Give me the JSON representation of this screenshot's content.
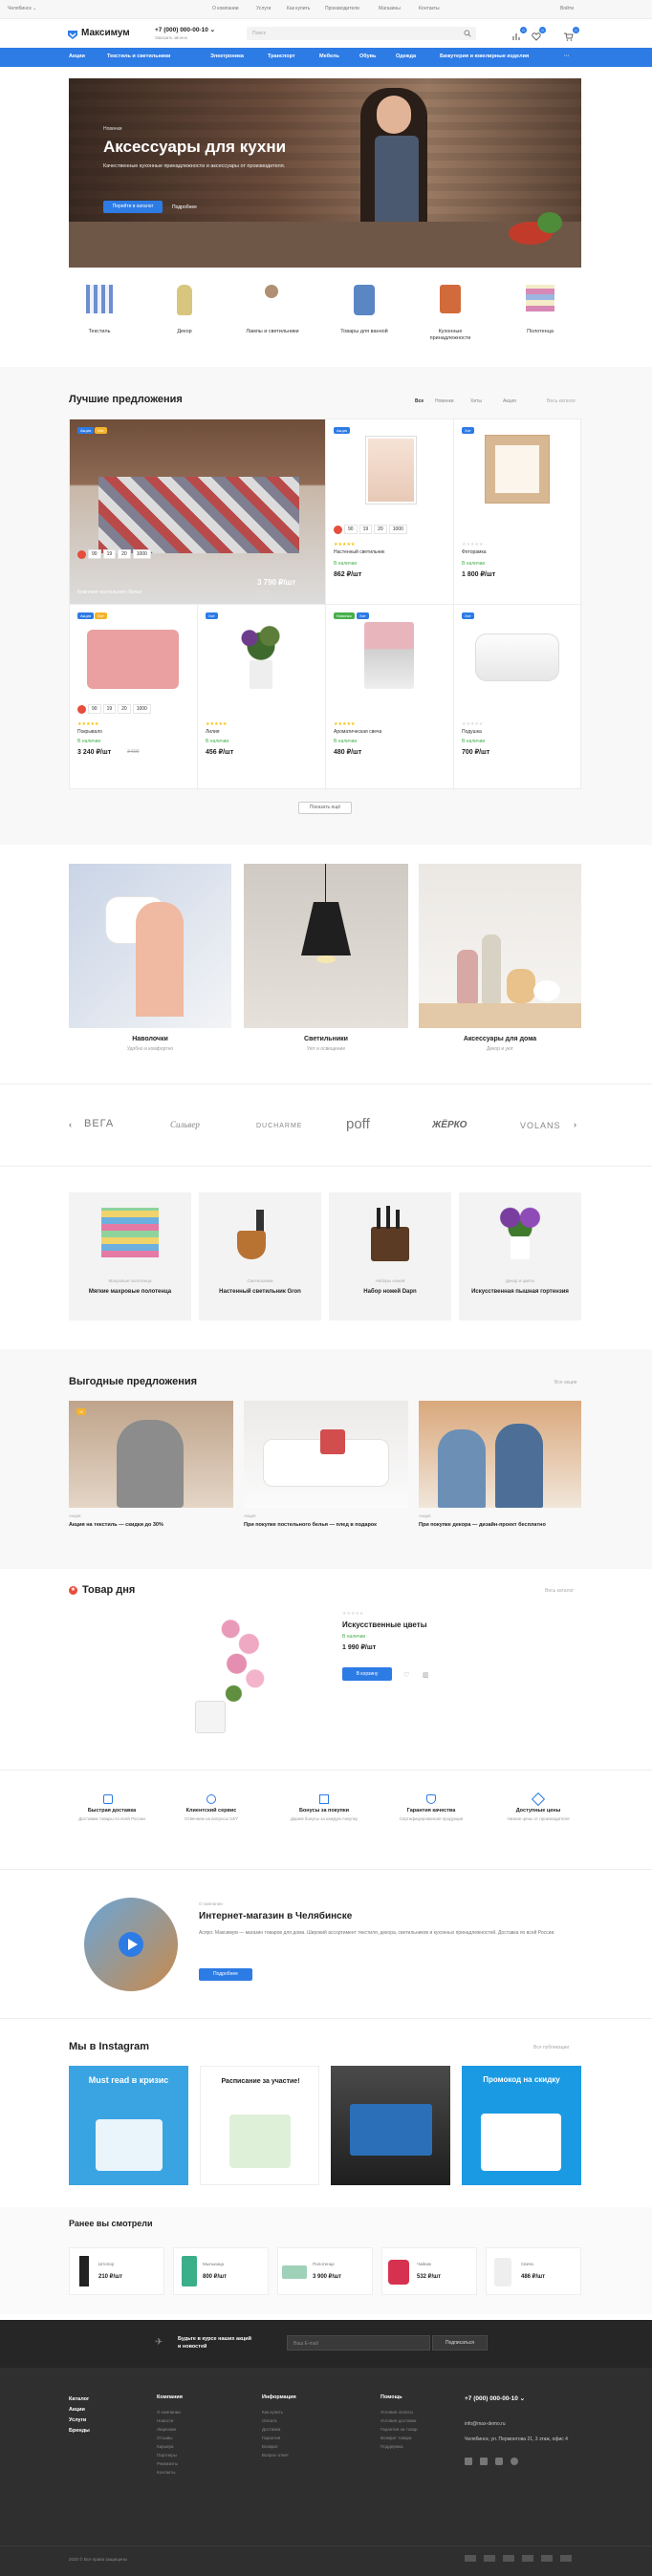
{
  "topbar": {
    "city": "Челябинск ⌄",
    "links": [
      "О компании",
      "Услуги",
      "Как купить",
      "Производители",
      "Магазины",
      "Контакты"
    ],
    "login": "Войти"
  },
  "header": {
    "logo": "Максимум",
    "phone": "+7 (000) 000-00-10 ⌄",
    "phone_sub": "Заказать звонок",
    "search_placeholder": "Поиск",
    "compare_count": "0",
    "fav_count": "0",
    "cart_count": "0"
  },
  "nav": {
    "items": [
      "Акции",
      "Текстиль и светильники",
      "Электроника",
      "Транспорт",
      "Мебель",
      "Обувь",
      "Одежда",
      "Бижутерия и ювелирные изделия",
      "···"
    ]
  },
  "hero": {
    "kicker": "Новинки",
    "title": "Аксессуары для кухни",
    "text": "Качественные кухонные принадлежности и аксессуары от производителя.",
    "button": "Перейти в каталог",
    "button2": "Подробнее"
  },
  "categories": [
    "Текстиль",
    "Декор",
    "Лампы и светильники",
    "Товары для ванной",
    "Кухонные принадлежности",
    "Полотенца"
  ],
  "best": {
    "title": "Лучшие предложения",
    "tabs": [
      "Все",
      "Новинки",
      "Хиты",
      "Акция"
    ],
    "all_link": "Весь каталог",
    "timer": [
      "90",
      "19",
      "20",
      "1000"
    ],
    "products": [
      {
        "name": "Комплект постельного белья",
        "price": "3 790 ₽/шт",
        "old": "4 760",
        "badges": [
          "Акция",
          "Хит"
        ]
      },
      {
        "name": "Настенный светильник",
        "price": "862 ₽/шт",
        "old": "",
        "badges": [
          "Акция"
        ],
        "stock": "В наличии"
      },
      {
        "name": "Фоторамка",
        "price": "1 800 ₽/шт",
        "old": "",
        "badges": [
          "Хит"
        ],
        "stock": "В наличии"
      },
      {
        "name": "Покрывало",
        "price": "3 240 ₽/шт",
        "old": "3 600",
        "badges": [
          "Акция",
          "Хит"
        ],
        "stock": "В наличии"
      },
      {
        "name": "Лилия",
        "price": "456 ₽/шт",
        "old": "",
        "badges": [
          "Хит"
        ],
        "stock": "В наличии"
      },
      {
        "name": "Ароматическая свеча",
        "price": "480 ₽/шт",
        "old": "",
        "badges": [
          "Новинка",
          "Хит"
        ],
        "stock": "В наличии"
      },
      {
        "name": "Подушка",
        "price": "700 ₽/шт",
        "old": "",
        "badges": [
          "Хит"
        ],
        "stock": "В наличии"
      }
    ],
    "more_button": "Показать ещё"
  },
  "collections": [
    {
      "title": "Наволочки",
      "sub": "Удобно и комфортно"
    },
    {
      "title": "Светильники",
      "sub": "Уют и освещение"
    },
    {
      "title": "Аксессуары для дома",
      "sub": "Декор и уют"
    }
  ],
  "brands": [
    "ВЕГА",
    "Сильвер",
    "DUCHARME",
    "poff",
    "ЖЁРКО",
    "VOLANS"
  ],
  "mini_products": [
    {
      "cat": "Махровые полотенца",
      "name": "Мягкие махровые полотенца"
    },
    {
      "cat": "Светильники",
      "name": "Настенный светильник Gron"
    },
    {
      "cat": "Наборы ножей",
      "name": "Набор ножей Dapn"
    },
    {
      "cat": "Декор и цветы",
      "name": "Искусственная пышная гортензия"
    }
  ],
  "offers": {
    "title": "Выгодные предложения",
    "all_link": "Все акции",
    "items": [
      {
        "date": "Акция",
        "text": "Акция на текстиль — скидки до 30%"
      },
      {
        "date": "Акция",
        "text": "При покупке постельного белья — плед в подарок"
      },
      {
        "date": "Акция",
        "text": "При покупке декора — дизайн-проект бесплатно"
      }
    ]
  },
  "day": {
    "title": "Товар дня",
    "all_link": "Весь каталог",
    "name": "Искусственные цветы",
    "stock": "В наличии",
    "price": "1 990 ₽/шт",
    "button": "В корзину"
  },
  "features": [
    {
      "title": "Быстрая доставка",
      "text": "Доставим товары по всей России"
    },
    {
      "title": "Клиентский сервис",
      "text": "Отвечаем на вопросы 24/7"
    },
    {
      "title": "Бонусы за покупки",
      "text": "Дарим бонусы за каждую покупку"
    },
    {
      "title": "Гарантия качества",
      "text": "Сертифицированная продукция"
    },
    {
      "title": "Доступные цены",
      "text": "Низкие цены от производителя"
    }
  ],
  "about": {
    "kicker": "О компании",
    "title": "Интернет-магазин в Челябинске",
    "text": "Аспро: Максимум — магазин товаров для дома. Широкий ассортимент текстиля, декора, светильников и кухонных принадлежностей. Доставка по всей России.",
    "button": "Подробнее"
  },
  "instagram": {
    "title": "Мы в Instagram",
    "link": "Все публикации",
    "posts": [
      "Must read в кризис",
      "Расписание за участие!",
      "",
      "Промокод на скидку"
    ]
  },
  "recent": {
    "title": "Ранее вы смотрели",
    "items": [
      {
        "name": "Штопор",
        "price": "210 ₽/шт"
      },
      {
        "name": "Мыльница",
        "price": "800 ₽/шт"
      },
      {
        "name": "Полотенце",
        "price": "3 900 ₽/шт"
      },
      {
        "name": "Чайник",
        "price": "532 ₽/шт"
      },
      {
        "name": "Свеча",
        "price": "486 ₽/шт"
      }
    ]
  },
  "subscribe": {
    "text": "Будьте в курсе наших акций и новостей",
    "placeholder": "Ваш E-mail",
    "button": "Подписаться"
  },
  "footer": {
    "col1": [
      "Каталог",
      "Акции",
      "Услуги",
      "Бренды"
    ],
    "col2_title": "Компания",
    "col2": [
      "О компании",
      "Новости",
      "Лицензии",
      "Отзывы",
      "Карьера",
      "Партнеры",
      "Реквизиты",
      "Контакты"
    ],
    "col3_title": "Информация",
    "col3": [
      "Как купить",
      "Оплата",
      "Доставка",
      "Гарантия",
      "Возврат",
      "Вопрос-ответ"
    ],
    "col4_title": "Помощь",
    "col4": [
      "Условия оплаты",
      "Условия доставки",
      "Гарантия на товар",
      "Возврат товара",
      "Поддержка"
    ],
    "phone": "+7 (000) 000-00-10 ⌄",
    "email": "info@max-demo.ru",
    "address": "Челябинск, ул. Пермонтова 21, 3 этаж, офис 4",
    "copyright": "2020 © Все права защищены"
  },
  "colors": {
    "accent": "#2d7be5",
    "dark": "#2f2f2f"
  }
}
